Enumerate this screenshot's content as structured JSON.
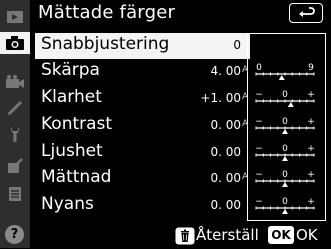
{
  "header": {
    "title": "Mättade färger"
  },
  "rows": [
    {
      "label": "Snabbjustering",
      "value": "0",
      "scale_type": "pm",
      "marker": 0.5,
      "auto": false
    },
    {
      "label": "Skärpa",
      "value": "4. 00",
      "scale_type": "range",
      "scale_min": "0",
      "scale_max": "9",
      "marker": 0.444,
      "auto": true
    },
    {
      "label": "Klarhet",
      "value": "+1. 00",
      "scale_type": "pm",
      "marker": 0.6,
      "auto": true
    },
    {
      "label": "Kontrast",
      "value": "0. 00",
      "scale_type": "pm",
      "marker": 0.5,
      "auto": true
    },
    {
      "label": "Ljushet",
      "value": "0. 00",
      "scale_type": "pm",
      "marker": 0.5,
      "auto": false
    },
    {
      "label": "Mättnad",
      "value": "0. 00",
      "scale_type": "pm",
      "marker": 0.5,
      "auto": true
    },
    {
      "label": "Nyans",
      "value": "0. 00",
      "scale_type": "pm",
      "marker": 0.5,
      "auto": false
    }
  ],
  "footer": {
    "reset_label": "Återställ",
    "ok_label": "OK",
    "ok_text": "OK"
  },
  "sidebar": {
    "tabs": [
      "playback-menu-icon",
      "photo-shooting-menu-icon",
      "movie-shooting-menu-icon",
      "custom-settings-icon",
      "setup-menu-icon",
      "retouch-menu-icon",
      "my-menu-icon"
    ],
    "help": "?"
  },
  "colors": {
    "selected_bg": "#f4f4f4",
    "sidebar_bg": "#2e2e2e",
    "help_bg": "#8a8a8a"
  }
}
